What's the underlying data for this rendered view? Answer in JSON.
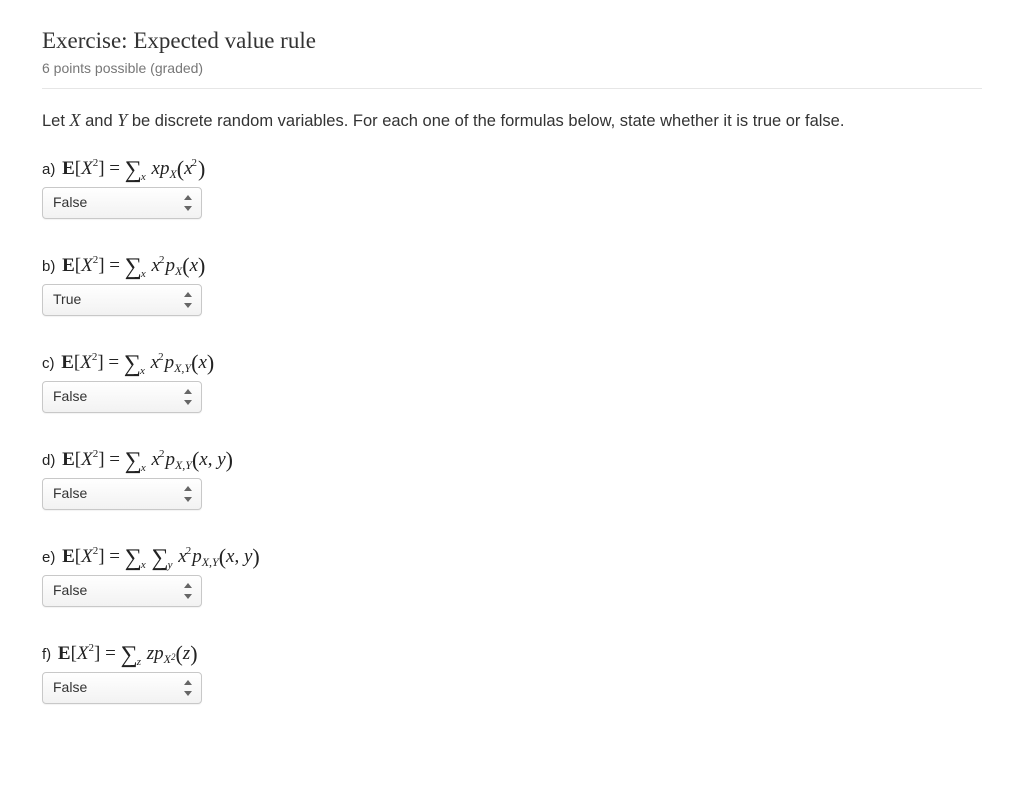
{
  "header": {
    "title": "Exercise: Expected value rule",
    "subhead": "6 points possible (graded)"
  },
  "intro": {
    "pre": "Let ",
    "var1": "X",
    "mid1": " and ",
    "var2": "Y",
    "post": " be discrete random variables. For each one of the formulas below, state whether it is true or false."
  },
  "questions": {
    "a": {
      "label": "a)",
      "answer": "False"
    },
    "b": {
      "label": "b)",
      "answer": "True"
    },
    "c": {
      "label": "c)",
      "answer": "False"
    },
    "d": {
      "label": "d)",
      "answer": "False"
    },
    "e": {
      "label": "e)",
      "answer": "False"
    },
    "f": {
      "label": "f)",
      "answer": "False"
    }
  },
  "select_options": [
    "True",
    "False"
  ]
}
